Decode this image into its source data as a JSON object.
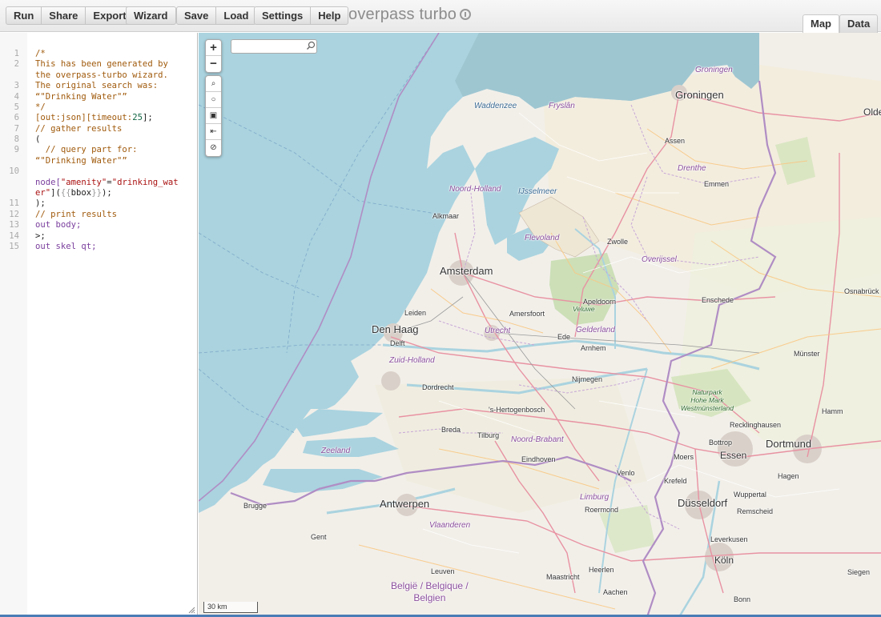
{
  "toolbar": {
    "groups": [
      [
        "Run",
        "Share",
        "Export"
      ],
      [
        "Wizard"
      ],
      [
        "Save",
        "Load"
      ],
      [
        "Settings",
        "Help"
      ]
    ],
    "brand": "overpass turbo"
  },
  "tabs": {
    "map": "Map",
    "data": "Data"
  },
  "editor": {
    "lines": [
      {
        "n": "1",
        "parts": [
          [
            "/*",
            "comment"
          ]
        ]
      },
      {
        "n": "2",
        "parts": [
          [
            "This has been generated by",
            "comment"
          ]
        ]
      },
      {
        "n": "",
        "parts": [
          [
            "the overpass-turbo wizard.",
            "comment"
          ]
        ]
      },
      {
        "n": "3",
        "parts": [
          [
            "The original search was:",
            "comment"
          ]
        ]
      },
      {
        "n": "4",
        "parts": [
          [
            "“\"Drinking Water\"”",
            "comment"
          ]
        ]
      },
      {
        "n": "5",
        "parts": [
          [
            "*/",
            "comment"
          ]
        ]
      },
      {
        "n": "6",
        "parts": [
          [
            "[out:json][timeout:",
            "comment"
          ],
          [
            "25",
            "num"
          ],
          [
            "];",
            "plain"
          ]
        ]
      },
      {
        "n": "7",
        "parts": [
          [
            "// gather results",
            "comment"
          ]
        ]
      },
      {
        "n": "8",
        "parts": [
          [
            "(",
            "plain"
          ]
        ]
      },
      {
        "n": "9",
        "parts": [
          [
            "  // query part for:",
            "comment"
          ]
        ]
      },
      {
        "n": "",
        "parts": [
          [
            "“\"Drinking Water\"”",
            "comment"
          ]
        ]
      },
      {
        "n": "10",
        "parts": [
          [
            "",
            "plain"
          ]
        ]
      },
      {
        "n": "",
        "parts": [
          [
            "node[",
            "kw"
          ],
          [
            "\"amenity\"",
            "str"
          ],
          [
            "=",
            "plain"
          ],
          [
            "\"drinking_wat",
            "str"
          ]
        ]
      },
      {
        "n": "",
        "parts": [
          [
            "er\"",
            "str"
          ],
          [
            "](",
            "plain"
          ],
          [
            "{{",
            "brk"
          ],
          [
            "bbox",
            "plain"
          ],
          [
            "}}",
            "brk"
          ],
          [
            ");",
            "plain"
          ]
        ]
      },
      {
        "n": "11",
        "parts": [
          [
            ");",
            "plain"
          ]
        ]
      },
      {
        "n": "12",
        "parts": [
          [
            "// print results",
            "comment"
          ]
        ]
      },
      {
        "n": "13",
        "parts": [
          [
            "out body;",
            "kw"
          ]
        ]
      },
      {
        "n": "14",
        "parts": [
          [
            ">;",
            "plain"
          ]
        ]
      },
      {
        "n": "15",
        "parts": [
          [
            "out skel qt;",
            "kw"
          ]
        ]
      }
    ]
  },
  "map": {
    "zoom_in": "+",
    "zoom_out": "−",
    "tools": [
      "⌕",
      "○",
      "▣",
      "⇤",
      "⊘"
    ],
    "search_placeholder": "",
    "scale": "30 km",
    "labels": {
      "groningen": "Groningen",
      "groningen_prov": "Groningen",
      "oldenburg": "Olde",
      "waddenzee": "Waddenzee",
      "fryslan": "Fryslân",
      "assen": "Assen",
      "drenthe": "Drenthe",
      "emmen": "Emmen",
      "noord_holland": "Noord-Holland",
      "ijsselmeer": "IJsselmeer",
      "alkmaar": "Alkmaar",
      "flevoland": "Flevoland",
      "zwolle": "Zwolle",
      "overijssel": "Overijssel",
      "amsterdam": "Amsterdam",
      "osnabruck": "Osnabrück",
      "apeldoorn": "Apeldoorn",
      "veluwe": "Veluwe",
      "enschede": "Enschede",
      "leiden": "Leiden",
      "amersfoort": "Amersfoort",
      "den_haag": "Den Haag",
      "utrecht": "Utrecht",
      "gelderland": "Gelderland",
      "delft": "Delft",
      "ede": "Ede",
      "arnhem": "Arnhem",
      "munster": "Münster",
      "zuid_holland": "Zuid-Holland",
      "nijmegen": "Nijmegen",
      "dordrecht": "Dordrecht",
      "hohe_mark": "Naturpark\nHohe Mark\nWestmünsterland",
      "hertogenbosch": "'s-Hertogenbosch",
      "hamm": "Hamm",
      "recklinghausen": "Recklinghausen",
      "breda": "Breda",
      "tilburg": "Tilburg",
      "noord_brabant": "Noord-Brabant",
      "bottrop": "Bottrop",
      "dortmund": "Dortmund",
      "zeeland": "Zeeland",
      "eindhoven": "Eindhoven",
      "moers": "Moers",
      "essen": "Essen",
      "venlo": "Venlo",
      "krefeld": "Krefeld",
      "hagen": "Hagen",
      "wuppertal": "Wuppertal",
      "brugge": "Brugge",
      "antwerpen": "Antwerpen",
      "limburg": "Limburg",
      "roermond": "Roermond",
      "dusseldorf": "Düsseldorf",
      "remscheid": "Remscheid",
      "vlaanderen": "Vlaanderen",
      "gent": "Gent",
      "leverkusen": "Leverkusen",
      "leuven": "Leuven",
      "heerlen": "Heerlen",
      "koln": "Köln",
      "siegen": "Siegen",
      "maastricht": "Maastricht",
      "belgie": "België / Belgique /\nBelgien",
      "aachen": "Aachen",
      "bonn": "Bonn"
    }
  }
}
